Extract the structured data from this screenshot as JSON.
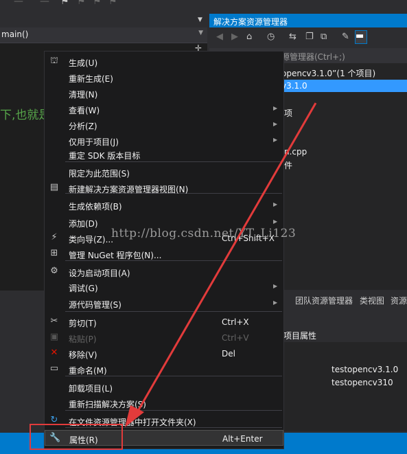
{
  "editor": {
    "function_selector": "main()",
    "comment_fragment": "下,也就是"
  },
  "solution_explorer": {
    "title": "解决方案资源管理器",
    "search_placeholder": "源管理器(Ctrl+;)",
    "tree": {
      "solution": "opencv3.1.0”(1 个项目)",
      "project": "v3.1.0",
      "item_refs": "项",
      "item_cpp": "n.cpp",
      "item_files": "件"
    }
  },
  "bottom_tabs": [
    "团队资源管理器",
    "类视图",
    "资源"
  ],
  "properties": {
    "header": "项目属性",
    "values": [
      "testopencv3.1.0",
      "testopencv310"
    ]
  },
  "context_menu": {
    "items": [
      {
        "label": "生成(U)",
        "icon": "build-icon"
      },
      {
        "label": "重新生成(E)"
      },
      {
        "label": "清理(N)"
      },
      {
        "label": "查看(W)",
        "submenu": true
      },
      {
        "label": "分析(Z)",
        "submenu": true
      },
      {
        "label": "仅用于项目(J)",
        "submenu": true
      },
      {
        "label": "重定 SDK 版本目标"
      },
      {
        "label": "限定为此范围(S)"
      },
      {
        "label": "新建解决方案资源管理器视图(N)",
        "icon": "new-view-icon"
      },
      {
        "label": "生成依赖项(B)",
        "submenu": true
      },
      {
        "label": "添加(D)",
        "submenu": true
      },
      {
        "label": "类向导(Z)...",
        "shortcut": "Ctrl+Shift+X",
        "icon": "class-wizard-icon"
      },
      {
        "label": "管理 NuGet 程序包(N)...",
        "icon": "nuget-icon"
      },
      {
        "label": "设为启动项目(A)",
        "icon": "gear-icon"
      },
      {
        "label": "调试(G)",
        "submenu": true
      },
      {
        "label": "源代码管理(S)",
        "submenu": true
      },
      {
        "label": "剪切(T)",
        "shortcut": "Ctrl+X",
        "icon": "scissors-icon"
      },
      {
        "label": "粘贴(P)",
        "shortcut": "Ctrl+V",
        "icon": "paste-icon",
        "disabled": true
      },
      {
        "label": "移除(V)",
        "shortcut": "Del",
        "icon": "remove-icon"
      },
      {
        "label": "重命名(M)",
        "icon": "rename-icon"
      },
      {
        "label": "卸载项目(L)"
      },
      {
        "label": "重新扫描解决方案(S)"
      },
      {
        "label": "在文件资源管理器中打开文件夹(X)",
        "icon": "refresh-folder-icon"
      },
      {
        "label": "属性(R)",
        "shortcut": "Alt+Enter",
        "icon": "wrench-icon",
        "highlighted": true
      }
    ]
  },
  "watermark": "http://blog.csdn.net/YT_Li123",
  "colors": {
    "accent": "#007acc",
    "annotation": "#e23b3b",
    "menu_bg": "#1b1b1c",
    "comment_green": "#57a64a"
  }
}
